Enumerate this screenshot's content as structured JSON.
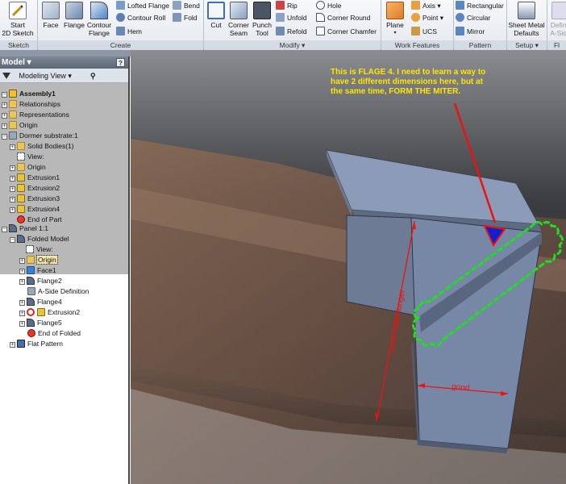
{
  "ribbon": {
    "sketch": {
      "start_label": "Start\n2D Sketch",
      "group": "Sketch"
    },
    "create": {
      "face": "Face",
      "flange": "Flange",
      "contour_flange": "Contour\nFlange",
      "lofted_flange": "Lofted Flange",
      "contour_roll": "Contour Roll",
      "hem": "Hem",
      "bend": "Bend",
      "fold": "Fold",
      "group": "Create"
    },
    "modify": {
      "cut": "Cut",
      "corner_seam": "Corner\nSeam",
      "punch_tool": "Punch\nTool",
      "rip": "Rip",
      "unfold": "Unfold",
      "refold": "Refold",
      "hole": "Hole",
      "corner_round": "Corner Round",
      "corner_chamfer": "Corner Chamfer",
      "group": "Modify ▾"
    },
    "work_features": {
      "plane": "Plane",
      "axis": "Axis ▾",
      "point": "Point ▾",
      "ucs": "UCS",
      "group": "Work Features"
    },
    "pattern": {
      "rectangular": "Rectangular",
      "circular": "Circular",
      "mirror": "Mirror",
      "group": "Pattern"
    },
    "setup": {
      "sheet_metal_defaults": "Sheet Metal\nDefaults",
      "group": "Setup ▾"
    },
    "partial": {
      "define_aside": "Define\nA-Side",
      "group": "Fl"
    }
  },
  "browser": {
    "title": "Model ▾",
    "help": "?",
    "view_mode": "Modeling View ▾",
    "tree": [
      {
        "label": "Assembly1",
        "bold": true
      },
      {
        "label": "Relationships"
      },
      {
        "label": "Representations"
      },
      {
        "label": "Origin"
      },
      {
        "label": "Dormer substrate:1"
      },
      {
        "label": "Solid Bodies(1)"
      },
      {
        "label": "View:"
      },
      {
        "label": "Origin"
      },
      {
        "label": "Extrusion1"
      },
      {
        "label": "Extrusion2"
      },
      {
        "label": "Extrusion3"
      },
      {
        "label": "Extrusion4"
      },
      {
        "label": "End of Part"
      },
      {
        "label": "Panel 1:1"
      },
      {
        "label": "Folded Model"
      },
      {
        "label": "View:"
      },
      {
        "label": "Origin"
      },
      {
        "label": "Face1"
      },
      {
        "label": "Flange2"
      },
      {
        "label": "A-Side Definition"
      },
      {
        "label": "Flange4"
      },
      {
        "label": "Extrusion2"
      },
      {
        "label": "Flange5"
      },
      {
        "label": "End of Folded"
      },
      {
        "label": "Flat Pattern"
      }
    ]
  },
  "viewport": {
    "annotation": "This is FLAGE 4. I need to learn a way to have 2 different dimensions here, but at the same time, FORM THE MITER.",
    "dim_vertical": "must make longer",
    "dim_horizontal": "good",
    "colors": {
      "annotation": "#ffe500",
      "arrow": "#ee1111",
      "marker": "#1020cc",
      "miter_outline": "#22dd22"
    }
  }
}
